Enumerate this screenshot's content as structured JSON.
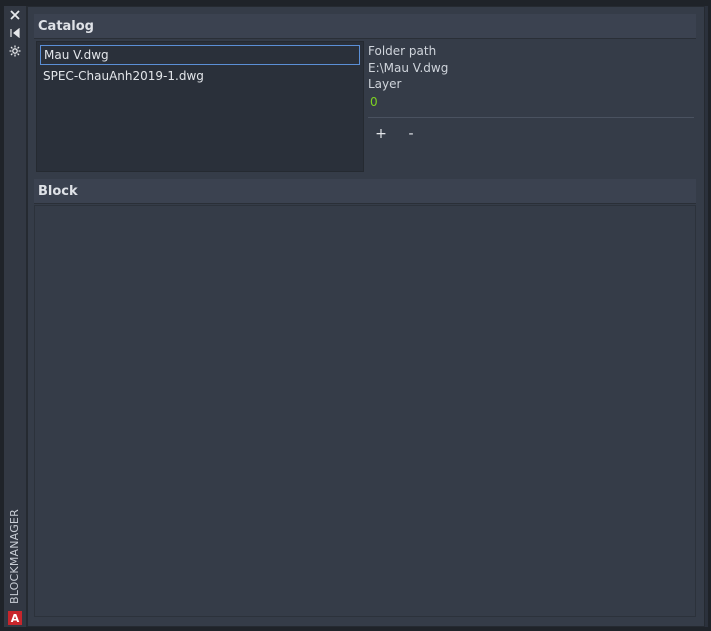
{
  "panel": {
    "title": "BLOCKMANAGER",
    "logo_letter": "A",
    "strip_icons": [
      "close-icon",
      "collapse-icon",
      "settings-icon"
    ]
  },
  "catalog": {
    "header": "Catalog",
    "files": [
      {
        "name": "Mau V.dwg",
        "selected": true
      },
      {
        "name": "SPEC-ChauAnh2019-1.dwg",
        "selected": false
      }
    ],
    "folder_path_label": "Folder path",
    "folder_path_value": "E:\\Mau V.dwg",
    "layer_label": "Layer",
    "layer_value": "0",
    "add_label": "+",
    "remove_label": "-"
  },
  "block": {
    "header": "Block"
  },
  "colors": {
    "background": "#2b313c",
    "panel": "#353c48",
    "header": "#3b4250",
    "selection_border": "#5b8fd6",
    "layer_value": "#7ed321",
    "logo": "#c8262c"
  }
}
